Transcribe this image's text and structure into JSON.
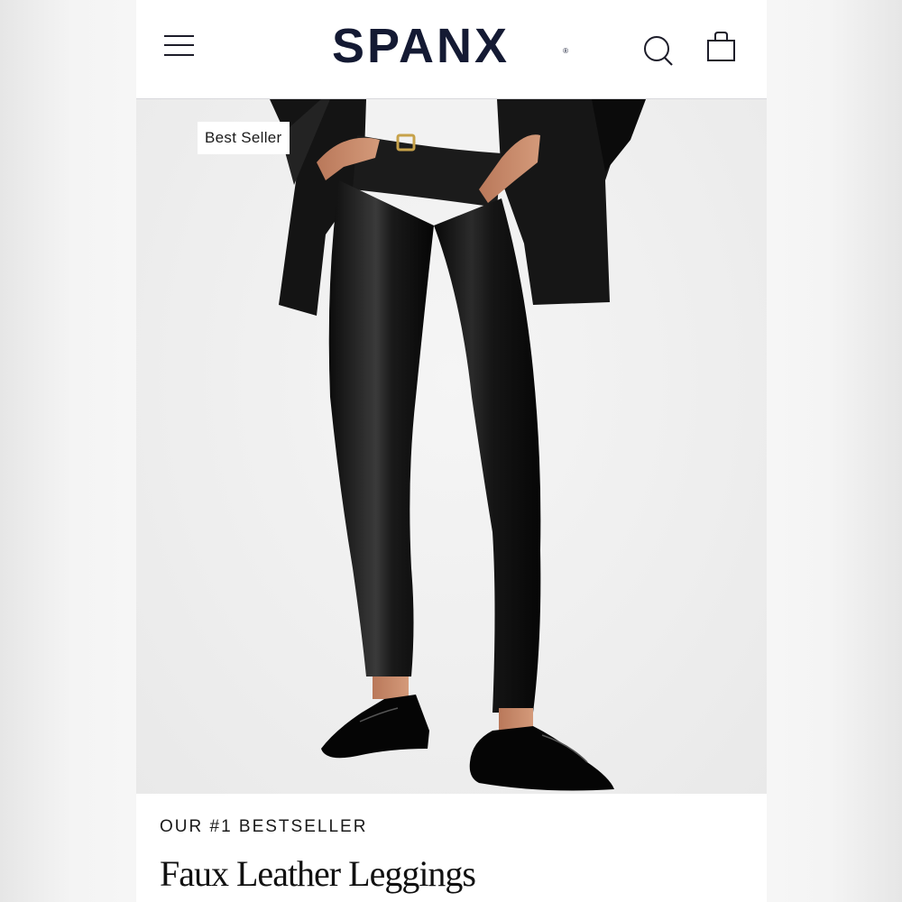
{
  "header": {
    "logo_text": "SPANX",
    "logo_mark": "®",
    "icons": [
      "hamburger-menu-icon",
      "search-icon",
      "shopping-bag-icon"
    ]
  },
  "hero": {
    "badge": "Best Seller"
  },
  "product": {
    "eyebrow": "OUR #1 BESTSELLER",
    "title": "Faux Leather Leggings"
  },
  "colors": {
    "brand_navy": "#141a33",
    "background": "#ffffff",
    "page_bg": "#f3f3f3"
  }
}
